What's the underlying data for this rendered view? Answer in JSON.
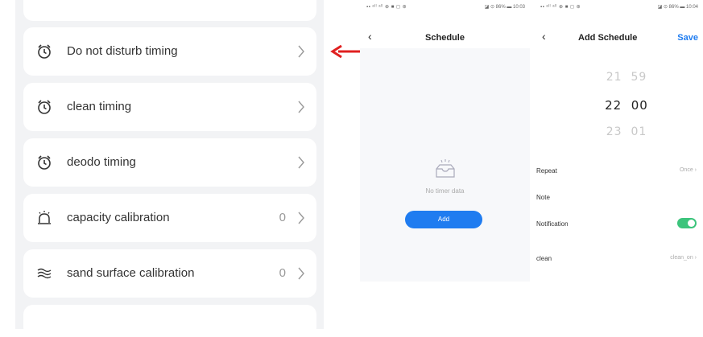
{
  "left_panel": {
    "items": [
      {
        "label": "Do not disturb timing",
        "icon": "alarm-clock-icon",
        "value": ""
      },
      {
        "label": "clean timing",
        "icon": "alarm-clock-icon",
        "value": ""
      },
      {
        "label": "deodo timing",
        "icon": "alarm-clock-icon",
        "value": ""
      },
      {
        "label": "capacity calibration",
        "icon": "bell-icon",
        "value": "0"
      },
      {
        "label": "sand surface calibration",
        "icon": "waves-icon",
        "value": "0"
      }
    ]
  },
  "annotation": {
    "arrow_color": "#e02020",
    "arrow_icon": "left-arrow-icon"
  },
  "phone_schedule": {
    "status_left": "▪▪ ᵃˡˡ ᵃˡˡ ⊕ ■ ◻ ⊛",
    "status_right": "◪ ⊙ 86% ▬ 10:03",
    "title": "Schedule",
    "empty_text": "No timer data",
    "add_label": "Add",
    "accent": "#1f7cf0"
  },
  "phone_add_schedule": {
    "status_left": "▪▪ ᵃˡˡ ᵃˡˡ ⊕ ■ ◻ ⊛",
    "status_right": "◪ ⊙ 86% ▬ 10:04",
    "title": "Add Schedule",
    "save_label": "Save",
    "time_picker": [
      {
        "hour": "21",
        "minute": "59"
      },
      {
        "hour": "22",
        "minute": "00"
      },
      {
        "hour": "23",
        "minute": "01"
      }
    ],
    "repeat_label": "Repeat",
    "repeat_value": "Once",
    "note_label": "Note",
    "notification_label": "Notification",
    "notification_on": true,
    "clean_label": "clean",
    "clean_value": "clean_on",
    "toggle_color": "#3cc47c"
  }
}
